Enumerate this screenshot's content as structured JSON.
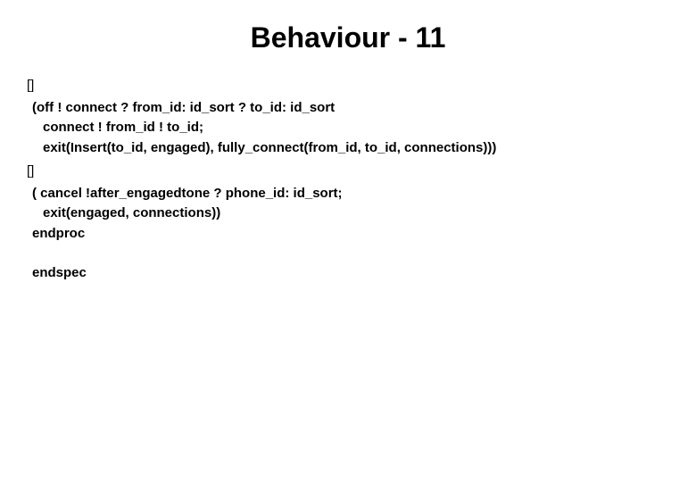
{
  "title": "Behaviour - 11",
  "bullet1": "[]",
  "block1": {
    "line1": "(off ! connect ? from_id: id_sort ? to_id: id_sort",
    "line2": "connect ! from_id ! to_id;",
    "line3": "exit(Insert(to_id, engaged), fully_connect(from_id, to_id, connections)))"
  },
  "bullet2": "[]",
  "block2": {
    "line1": "( cancel !after_engagedtone ? phone_id: id_sort;",
    "line2": "exit(engaged, connections))",
    "line3": "endproc"
  },
  "endspec": "endspec"
}
